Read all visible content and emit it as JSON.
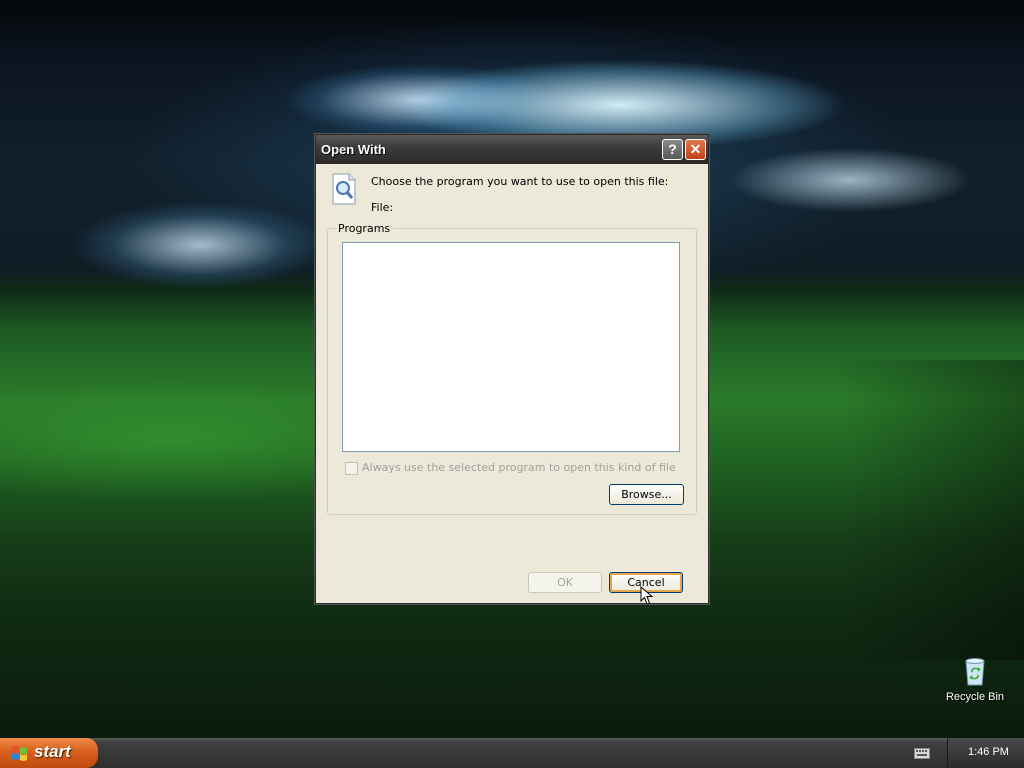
{
  "desktop": {
    "icons": [
      {
        "label": "Recycle Bin",
        "icon": "recycle-bin-icon"
      }
    ]
  },
  "dialog": {
    "title": "Open With",
    "title_buttons": {
      "help": "?",
      "close": "✕"
    },
    "prompt": "Choose the program you want to use to open this file:",
    "file_label": "File:",
    "programs_group_label": "Programs",
    "programs": [],
    "always_use_label": "Always use the selected program to open this kind of file",
    "always_use_checked": false,
    "always_use_enabled": false,
    "browse_label": "Browse...",
    "ok_label": "OK",
    "ok_enabled": false,
    "cancel_label": "Cancel"
  },
  "taskbar": {
    "start_label": "start",
    "clock": "1:46 PM",
    "tray_icons": [
      "keyboard-icon"
    ]
  },
  "colors": {
    "start_button": "#d8601c",
    "taskbar": "#3f3f3f",
    "dialog_face": "#ece9d8",
    "close_button": "#c2401a"
  }
}
